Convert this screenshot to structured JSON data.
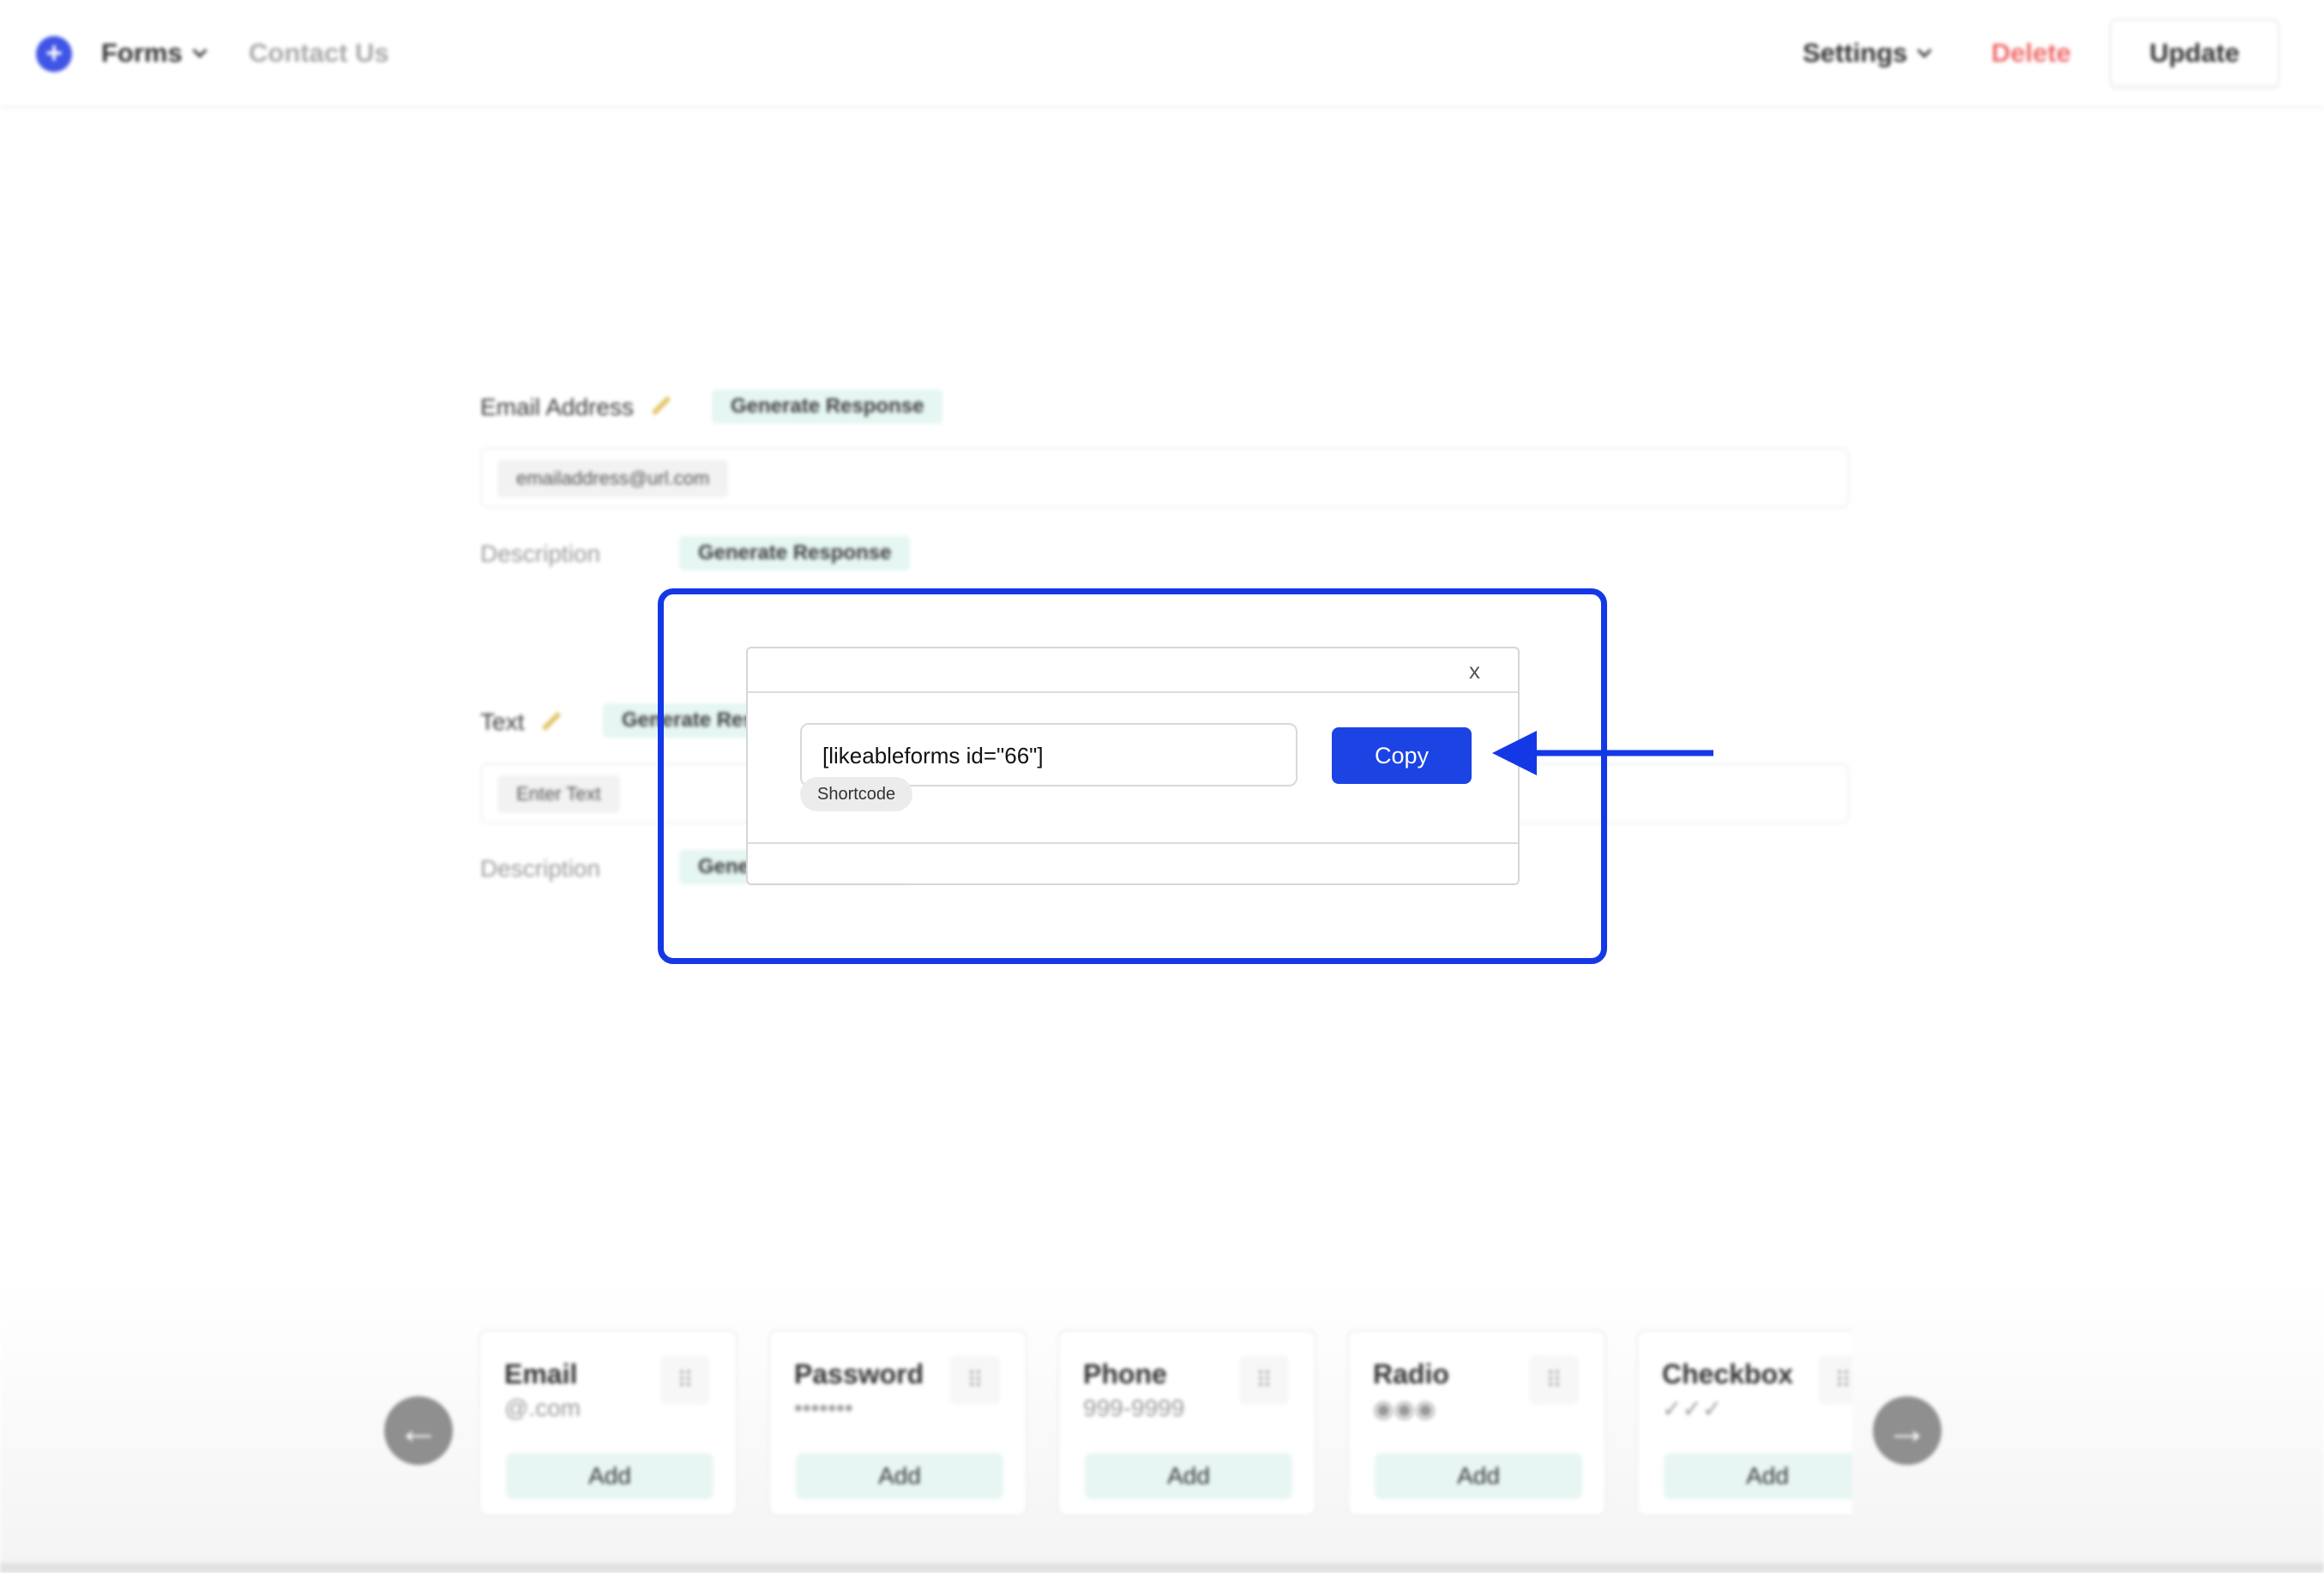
{
  "header": {
    "nav_forms": "Forms",
    "nav_contact": "Contact Us",
    "nav_settings": "Settings",
    "delete_label": "Delete",
    "update_label": "Update",
    "logo_icon": "plus-circle-icon",
    "accent_color": "#3f55e6"
  },
  "form": {
    "fields": [
      {
        "label": "Email Address",
        "generate_label": "Generate Response",
        "placeholder": "emailaddress@url.com",
        "description_label": "Description",
        "description_generate_label": "Generate Response"
      },
      {
        "label": "Text",
        "generate_label": "Generate Response",
        "placeholder": "Enter Text",
        "description_label": "Description",
        "description_generate_label": "Generate Response"
      }
    ]
  },
  "dialog": {
    "close_label": "x",
    "shortcode_value": "[likeableforms id=\"66\"]",
    "shortcode_label": "Shortcode",
    "copy_label": "Copy",
    "highlight_color": "#1438e6",
    "button_color": "#1c44e4"
  },
  "palette": {
    "cards": [
      {
        "title": "Email",
        "sample": "@.com",
        "add_label": "Add"
      },
      {
        "title": "Password",
        "sample": "•••••••",
        "add_label": "Add"
      },
      {
        "title": "Phone",
        "sample": "999-9999",
        "add_label": "Add"
      },
      {
        "title": "Radio",
        "sample": "◉◉◉",
        "add_label": "Add"
      },
      {
        "title": "Checkbox",
        "sample": "✓✓✓",
        "add_label": "Add"
      }
    ],
    "prev_icon": "arrow-left-icon",
    "next_icon": "arrow-right-icon"
  }
}
